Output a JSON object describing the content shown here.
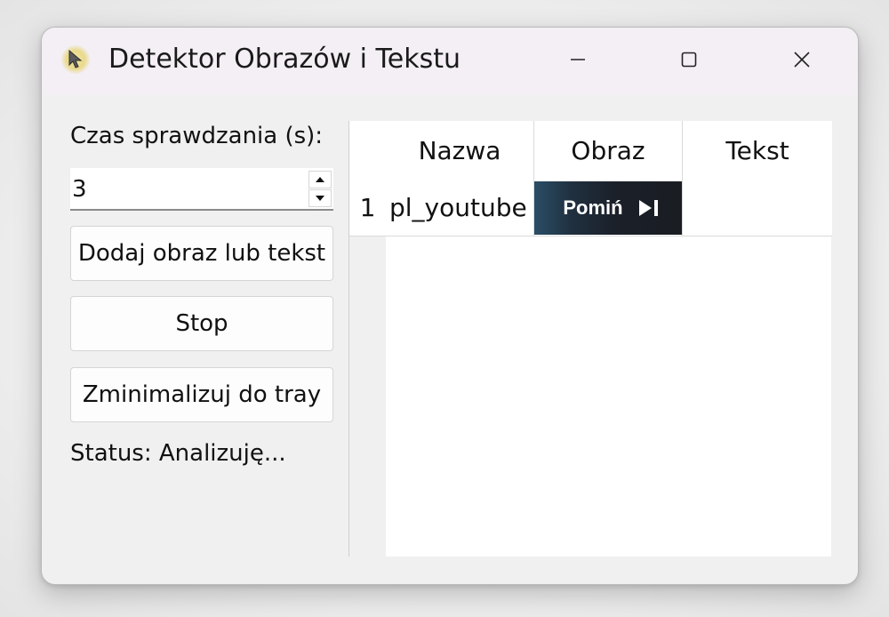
{
  "window": {
    "title": "Detektor Obrazów i Tekstu",
    "icon": "app-cursor-icon"
  },
  "controls": {
    "interval_label": "Czas sprawdzania (s):",
    "interval_value": "3",
    "add_button": "Dodaj obraz lub tekst",
    "stop_button": "Stop",
    "tray_button": "Zminimalizuj do tray",
    "status": "Status: Analizuję..."
  },
  "table": {
    "headers": [
      "Nazwa",
      "Obraz",
      "Tekst"
    ],
    "rows": [
      {
        "num": "1",
        "name": "pl_youtube",
        "image_text": "Pomiń",
        "text": ""
      }
    ]
  },
  "colors": {
    "titlebar": "#f3eff4",
    "window_bg": "#f0f0f0",
    "thumb_bg": "#1b2029"
  }
}
